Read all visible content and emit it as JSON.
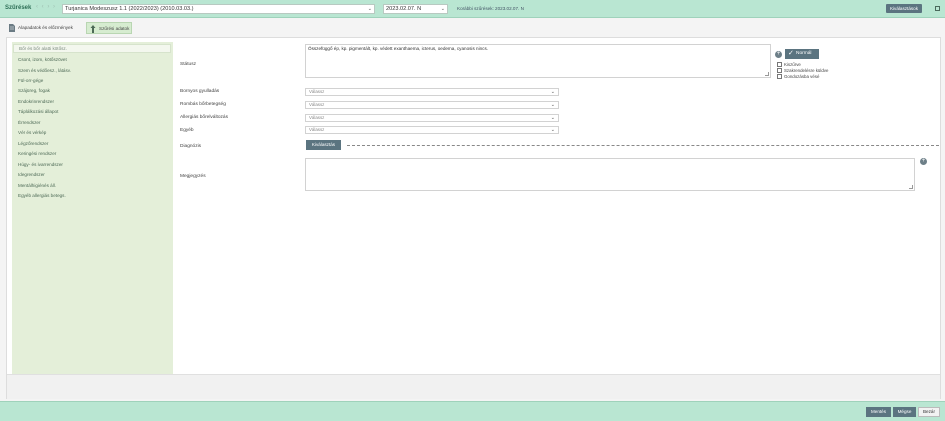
{
  "header": {
    "title": "Szűrések",
    "nav_arrows": "‹ ‹ › ›",
    "eset_select": "Turjanica Modeszusz 1.1 (2022/2023) (2010.03.03.)",
    "date_select": "2023.02.07. N",
    "korabbi": "Korábbi szűrések: 2023.02.07. N",
    "kivalasztasok_label": "Kiválasztások"
  },
  "tabs": [
    {
      "label": "Alapadatok és előzmények",
      "icon": "document-icon"
    },
    {
      "label": "Szűrési adatok",
      "icon": "person-upload-icon"
    }
  ],
  "sidebar": {
    "items": [
      {
        "label": "Bőr és bőr alatti kötősz."
      },
      {
        "label": "Csont, izom, kötőszövet"
      },
      {
        "label": "Szem és védőesz., látásv."
      },
      {
        "label": "Fül-orr-gége"
      },
      {
        "label": "Szájüreg, fogak"
      },
      {
        "label": "Endokrinrendszer"
      },
      {
        "label": "Táplálkozási állapot"
      },
      {
        "label": "Érrendszer"
      },
      {
        "label": "Vér és vérkép"
      },
      {
        "label": "Légzőrendszer"
      },
      {
        "label": "Keringési rendszer"
      },
      {
        "label": "Húgy- és ivarrendszer"
      },
      {
        "label": "Idegrendszer"
      },
      {
        "label": "Mentálhigiénés áll."
      },
      {
        "label": "Egyéb allergiás betegs."
      }
    ]
  },
  "form": {
    "statusz_label": "Státusz",
    "statusz_text": "Összefüggő ép, kp. pigmentált, kp. védett exanthaema, icterus, oedema, cyanosis nincs.",
    "normal_label": "Normál",
    "checkboxes": [
      "Kiszűrve",
      "Szakrendelésre küldve",
      "Gondozásba vésé"
    ],
    "fields": [
      {
        "label": "Bornyos gyulladás",
        "placeholder": "Válassz"
      },
      {
        "label": "Rombás bőrbetegség",
        "placeholder": "Válassz"
      },
      {
        "label": "Allergiás bőrelváltozás",
        "placeholder": "Válassz"
      },
      {
        "label": "Egyéb",
        "placeholder": "Válassz"
      }
    ],
    "diagnozis_label": "Diagnózis",
    "kivalasztas_label": "Kiválasztás",
    "megjegyzes_label": "Megjegyzés"
  },
  "footer": {
    "mentes_label": "Mentés",
    "megse_label": "Mégse",
    "bezar_label": "Bezár"
  },
  "colors": {
    "header_bg": "#b9e6d2",
    "sidebar_bg": "#e4efd9",
    "button_bg": "#5b7480"
  }
}
